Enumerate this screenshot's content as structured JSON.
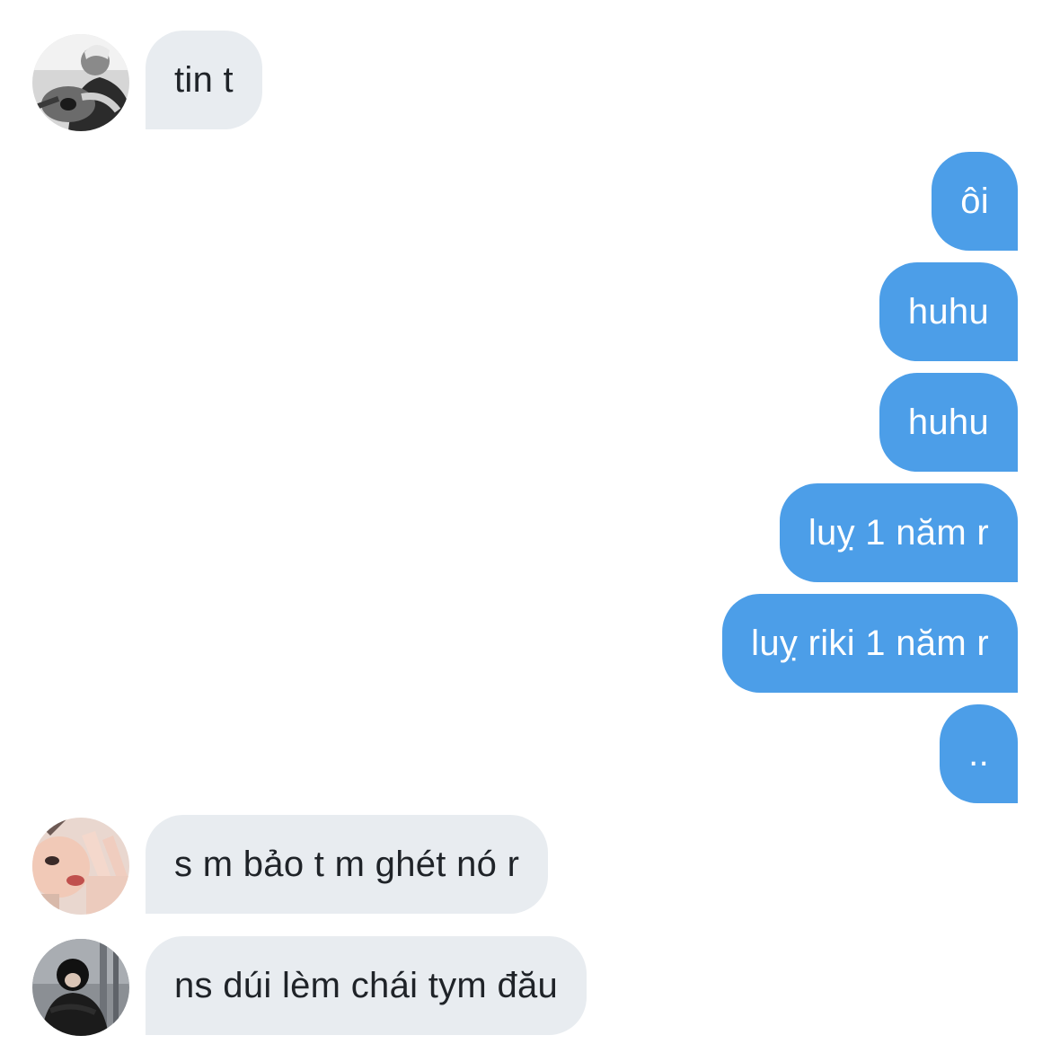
{
  "conversation": {
    "messages": [
      {
        "sender": "other",
        "text": "tin t",
        "avatar": "guitar-player-avatar"
      },
      {
        "sender": "me",
        "text": "ôi"
      },
      {
        "sender": "me",
        "text": "huhu"
      },
      {
        "sender": "me",
        "text": "huhu"
      },
      {
        "sender": "me",
        "text": "luỵ 1 năm r"
      },
      {
        "sender": "me",
        "text": "luỵ riki 1 năm r"
      },
      {
        "sender": "me",
        "text": ".."
      },
      {
        "sender": "other",
        "text": "s m bảo t m ghét nó r",
        "avatar": "peace-sign-avatar"
      },
      {
        "sender": "other",
        "text": "ns dúi lèm chái tym đău",
        "avatar": "dark-jacket-avatar"
      }
    ]
  },
  "colors": {
    "incoming_bubble": "#e8ecf0",
    "outgoing_bubble": "#4c9ee8",
    "incoming_text": "#1f2328",
    "outgoing_text": "#ffffff"
  }
}
